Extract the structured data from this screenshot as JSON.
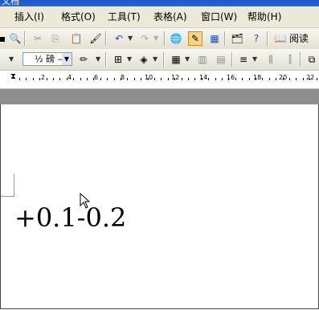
{
  "window": {
    "title_fragment": "文档"
  },
  "menubar": {
    "items": [
      {
        "label": "插入(I)"
      },
      {
        "label": "格式(O)"
      },
      {
        "label": "工具(T)"
      },
      {
        "label": "表格(A)"
      },
      {
        "label": "窗口(W)"
      },
      {
        "label": "帮助(H)"
      }
    ]
  },
  "toolbar_standard": {
    "read_label": "阅读"
  },
  "toolbar_formatting": {
    "font_size_value": "½ 磅",
    "font_size_placeholder": "—"
  },
  "ruler": {
    "labels": [
      "2",
      "4",
      "6",
      "8",
      "10",
      "12",
      "14",
      "16",
      "18",
      "20",
      "22"
    ]
  },
  "document": {
    "text": "+0.1-0.2"
  },
  "icons": {
    "colors": {
      "title_blue": "#1c56c9",
      "menu_bg": "#ece9d8",
      "highlight": "#f9d58b"
    }
  }
}
